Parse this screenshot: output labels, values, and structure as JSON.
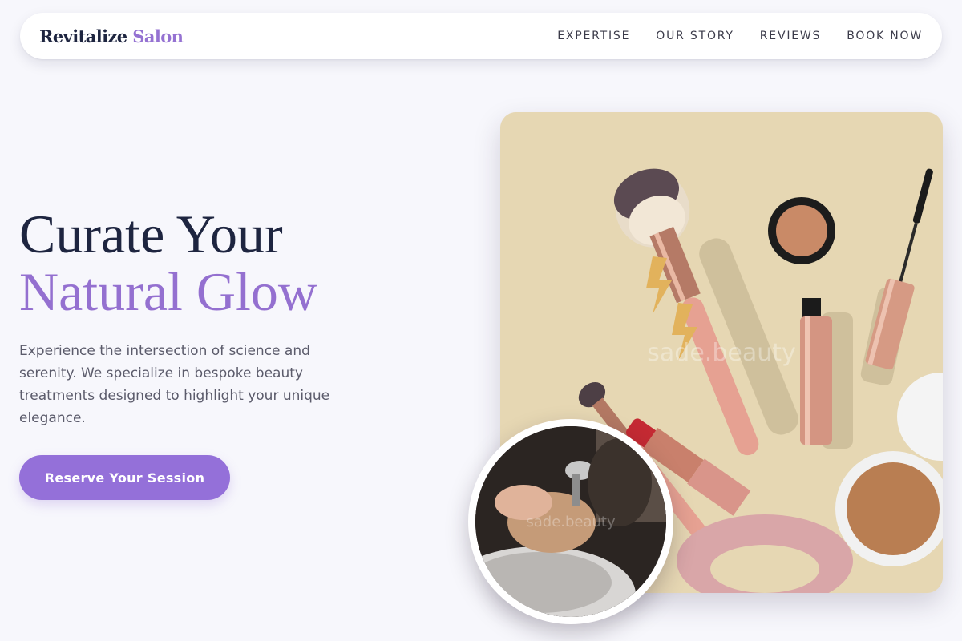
{
  "brand": {
    "name_primary": "Revitalize",
    "name_accent": "Salon"
  },
  "nav": {
    "items": [
      {
        "label": "EXPERTISE"
      },
      {
        "label": "OUR STORY"
      },
      {
        "label": "REVIEWS"
      },
      {
        "label": "BOOK NOW"
      }
    ]
  },
  "hero": {
    "title_line1": "Curate Your",
    "title_line2": "Natural Glow",
    "description": "Experience the intersection of science and serenity. We specialize in bespoke beauty treatments designed to highlight your unique elegance.",
    "cta_label": "Reserve Your Session",
    "main_image_watermark": "sade.beauty",
    "circle_image_watermark": "sade.beauty"
  },
  "colors": {
    "accent": "#9470d9",
    "heading": "#1e2540",
    "page_background": "#f7f7fc",
    "image_background": "#e6d7b3"
  }
}
